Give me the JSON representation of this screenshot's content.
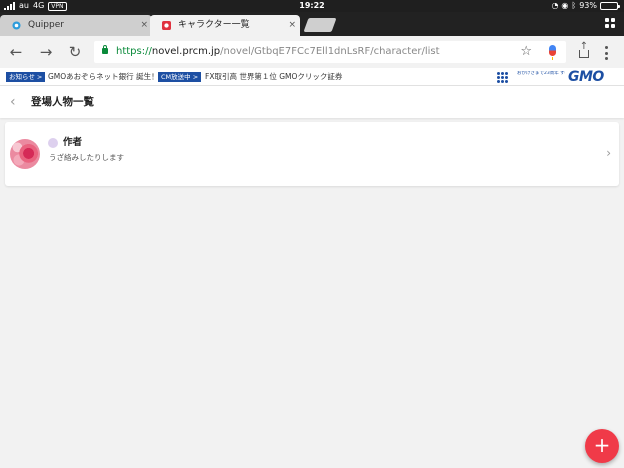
{
  "status_bar": {
    "carrier": "au",
    "network": "4G",
    "vpn": "VPN",
    "time": "19:22",
    "battery": "93%",
    "battery_level": 0.93
  },
  "browser": {
    "tabs": [
      {
        "title": "Quipper",
        "active": false,
        "favicon_color": "#2d9cdb"
      },
      {
        "title": "キャラクター一覧",
        "active": true,
        "favicon_color": "#e0323f"
      }
    ],
    "close_glyph": "×",
    "url": {
      "scheme": "https://",
      "host": "novel.prcm.jp",
      "path": "/novel/GtbqE7FCc7Ell1dnLsRF/character/list"
    }
  },
  "ticker": {
    "items": [
      {
        "badge": "お知らせ >",
        "text": "GMOあおぞらネット銀行 誕生！"
      },
      {
        "badge": "CM放送中 >",
        "text": "FX取引高 世界第１位 GMOクリック証券"
      }
    ],
    "brand_tagline": "おかげさまで23周年 すべての人にインターネットを",
    "brand_logo": "GMO"
  },
  "page": {
    "title": "登場人物一覧",
    "characters": [
      {
        "name": "作者",
        "description": "うざ絡みしたりします"
      }
    ],
    "fab_label": "+"
  },
  "colors": {
    "accent": "#f03a48",
    "url_green": "#0a8a3a",
    "gmo_blue": "#1d4fa3"
  }
}
